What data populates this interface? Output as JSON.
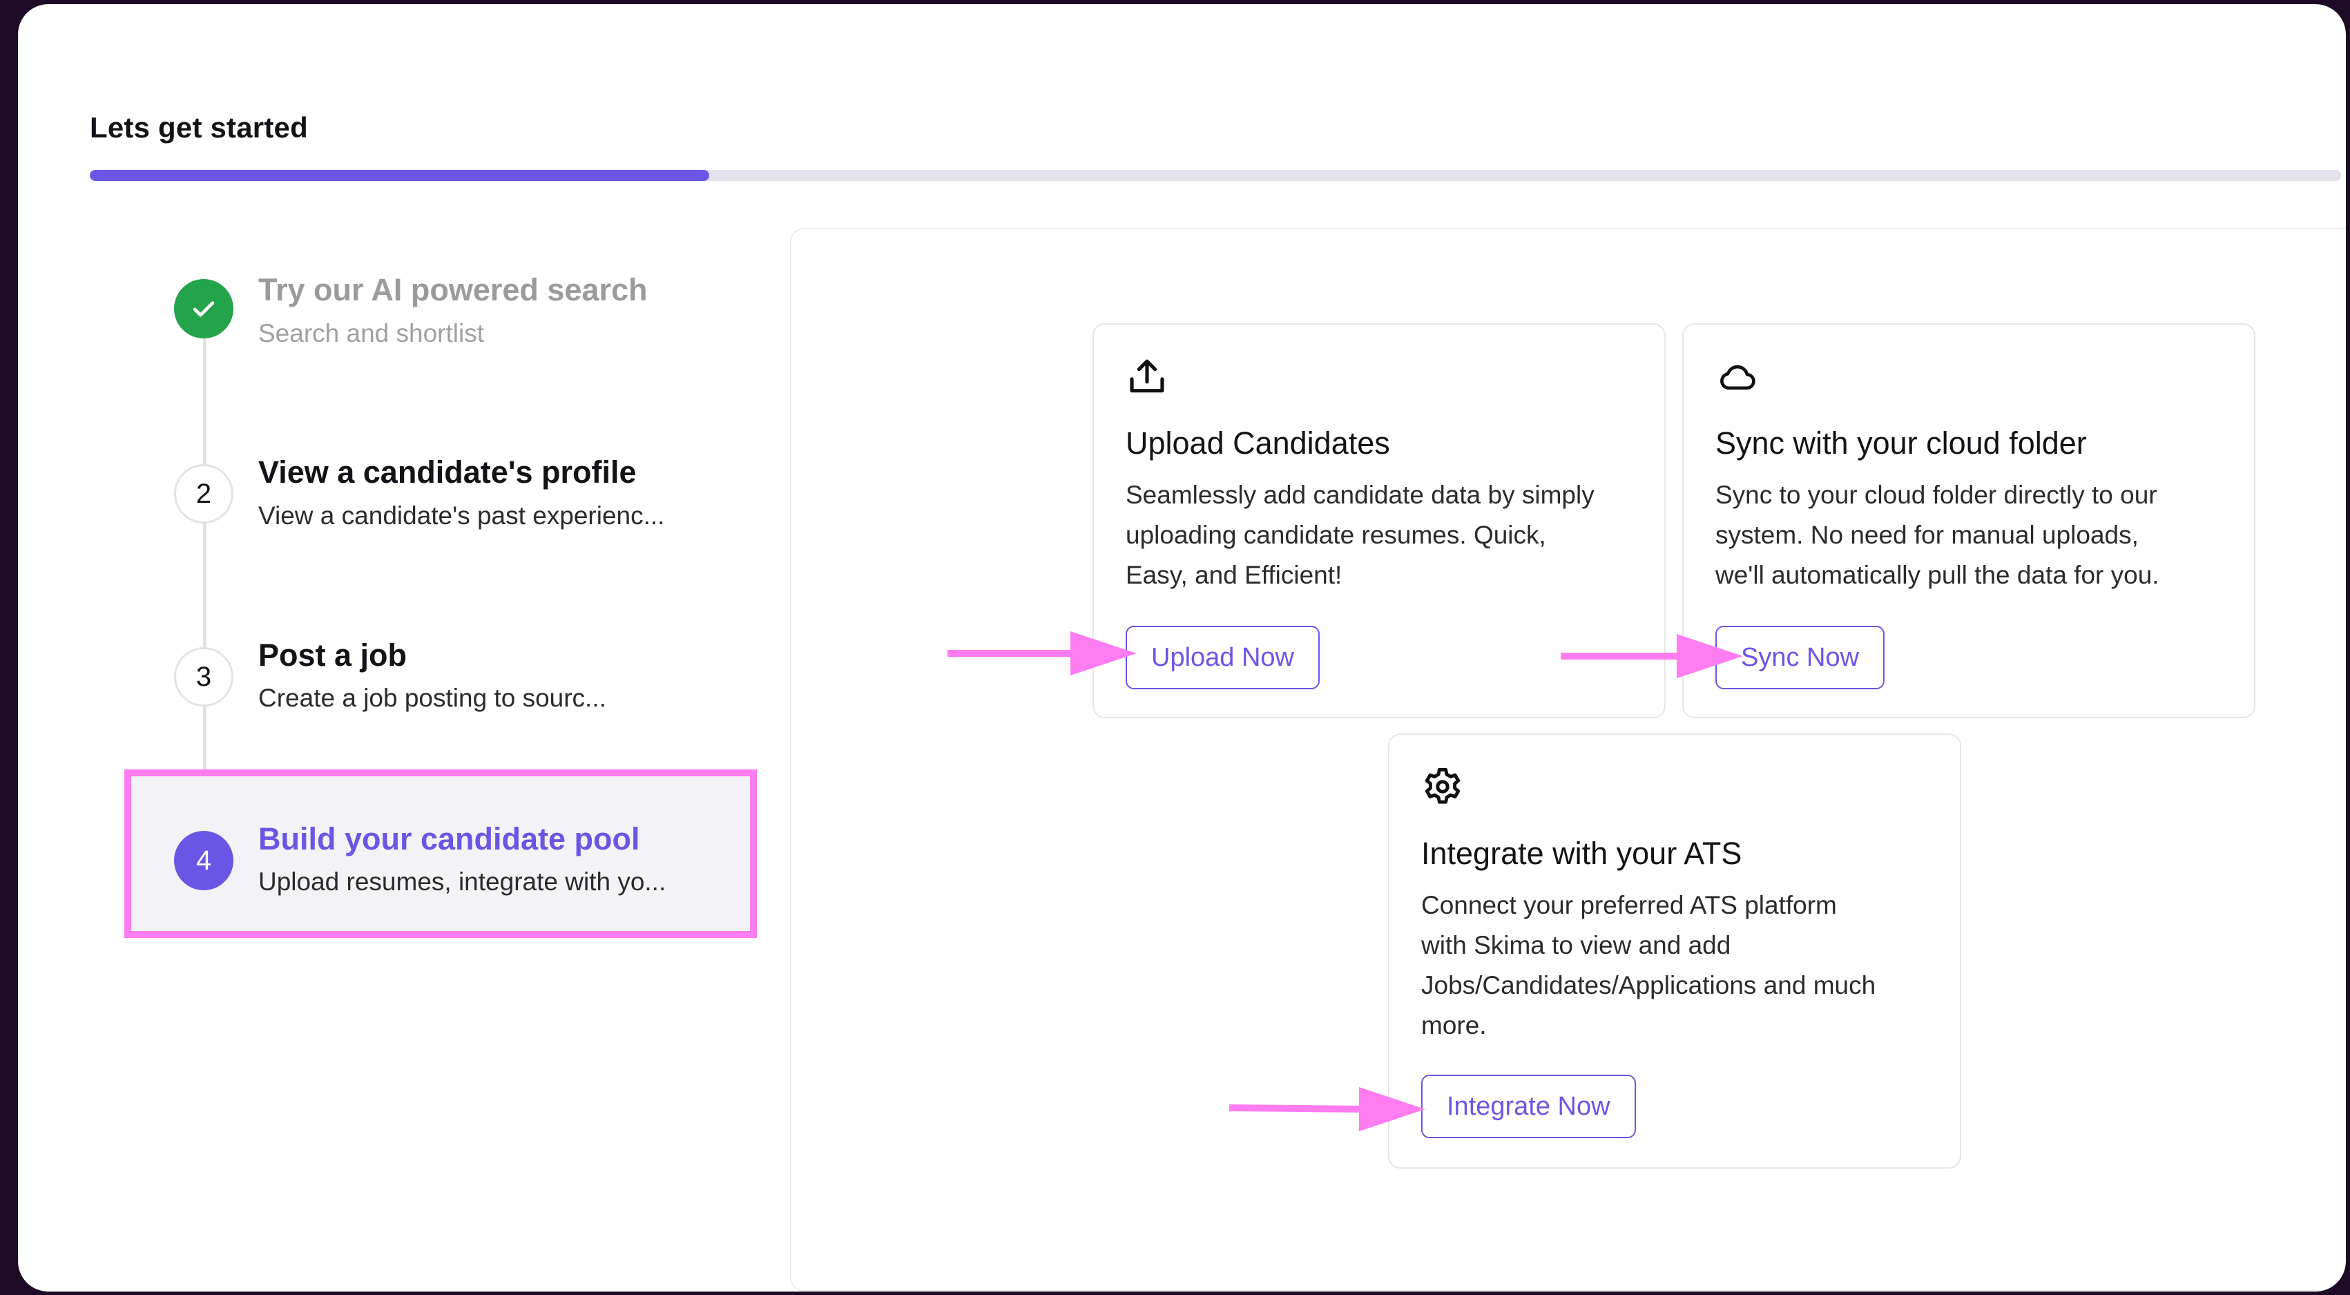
{
  "page_title": "Lets get started",
  "progress": {
    "fraction": 0.275,
    "track_color": "#e5e0ed",
    "fill_color": "#6a56e5"
  },
  "steps": [
    {
      "marker": "check-icon",
      "title": "Try our AI powered search",
      "subtitle": "Search and shortlist",
      "state": "done"
    },
    {
      "marker": "2",
      "title": "View a candidate's profile",
      "subtitle": "View a candidate's past experienc...",
      "state": "pending"
    },
    {
      "marker": "3",
      "title": "Post a job",
      "subtitle": "Create a job posting to sourc...",
      "state": "pending"
    },
    {
      "marker": "4",
      "title": "Build your candidate pool",
      "subtitle": "Upload resumes, integrate with yo...",
      "state": "active"
    }
  ],
  "cards": [
    {
      "icon": "upload-icon",
      "title": "Upload Candidates",
      "description": [
        "Seamlessly add candidate data by simply",
        "uploading candidate resumes. Quick,",
        "Easy, and Efficient!"
      ],
      "button": "Upload Now"
    },
    {
      "icon": "cloud-icon",
      "title": "Sync with your cloud folder",
      "description": [
        "Sync to your cloud folder directly to our",
        "system. No need for manual uploads,",
        "we'll automatically pull the data for you."
      ],
      "button": "Sync Now"
    },
    {
      "icon": "gear-icon",
      "title": "Integrate with your ATS",
      "description": [
        "Connect your preferred ATS platform",
        "with Skima to view and add",
        "Jobs/Candidates/Applications and much",
        "more."
      ],
      "button": "Integrate Now"
    }
  ],
  "colors": {
    "accent": "#6a56e5",
    "success": "#23a34a",
    "annotation_highlight": "#ff7df0",
    "frame_background": "#1c0a26"
  }
}
